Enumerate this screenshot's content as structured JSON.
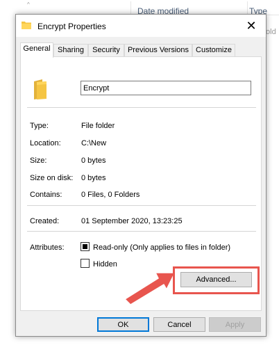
{
  "explorer": {
    "columns": [
      "Date modified",
      "Type"
    ],
    "row_tail": "fold"
  },
  "dialog": {
    "title": "Encrypt Properties",
    "close_label": "✕"
  },
  "tabs": [
    {
      "label": "General",
      "active": true
    },
    {
      "label": "Sharing",
      "active": false
    },
    {
      "label": "Security",
      "active": false
    },
    {
      "label": "Previous Versions",
      "active": false
    },
    {
      "label": "Customize",
      "active": false
    }
  ],
  "general": {
    "name_value": "Encrypt",
    "rows": [
      {
        "label": "Type:",
        "value": "File folder"
      },
      {
        "label": "Location:",
        "value": "C:\\New"
      },
      {
        "label": "Size:",
        "value": "0 bytes"
      },
      {
        "label": "Size on disk:",
        "value": "0 bytes"
      },
      {
        "label": "Contains:",
        "value": "0 Files, 0 Folders"
      }
    ],
    "created": {
      "label": "Created:",
      "value": "01 September 2020, 13:23:25"
    },
    "attributes": {
      "label": "Attributes:",
      "readonly_label": "Read-only (Only applies to files in folder)",
      "readonly_checked": true,
      "hidden_label": "Hidden",
      "hidden_checked": false,
      "advanced_label": "Advanced..."
    }
  },
  "footer": {
    "ok_label": "OK",
    "cancel_label": "Cancel",
    "apply_label": "Apply"
  },
  "colors": {
    "highlight": "#e8554e",
    "folder_yellow": "#f5c543",
    "accent": "#0078d7"
  }
}
